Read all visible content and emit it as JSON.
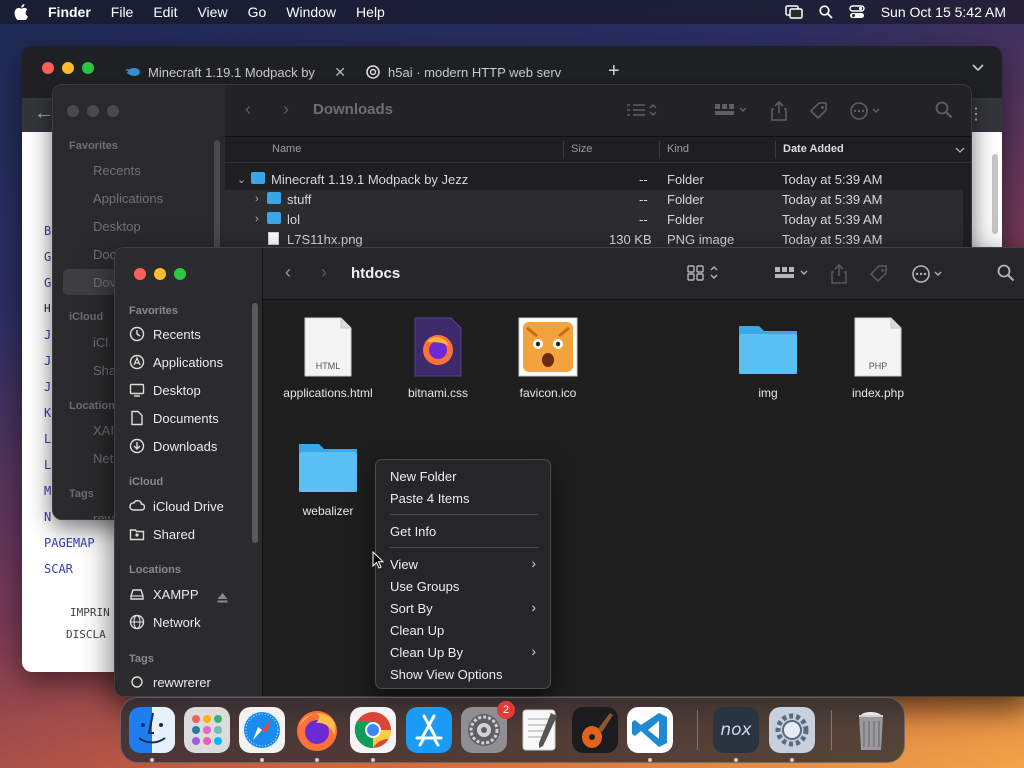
{
  "menubar": {
    "app": "Finder",
    "items": [
      "File",
      "Edit",
      "View",
      "Go",
      "Window",
      "Help"
    ],
    "datetime": "Sun Oct 15  5:42 AM"
  },
  "browser": {
    "tabs": [
      {
        "label": "Minecraft 1.19.1 Modpack by"
      },
      {
        "label": "h5ai · modern HTTP web serv"
      }
    ],
    "page_links": [
      "B",
      "G",
      "G",
      "H",
      "J",
      "J",
      "J",
      "K",
      "L",
      "L",
      "M",
      "N",
      "PAGEMAP",
      "SCAR"
    ],
    "page_text": [
      "IMPRIN",
      "DISCLA"
    ]
  },
  "finder_back": {
    "title": "Downloads",
    "sidebar": {
      "favorites_header": "Favorites",
      "favorites": [
        "Recents",
        "Applications",
        "Desktop",
        "Doc",
        "Dov"
      ],
      "icloud_header": "iCloud",
      "icloud": [
        "iCl",
        "Sha"
      ],
      "locations_header": "Location",
      "locations": [
        "XAI",
        "Net"
      ],
      "tags_header": "Tags",
      "tags": [
        "rew"
      ]
    },
    "columns": {
      "name": "Name",
      "size": "Size",
      "kind": "Kind",
      "date": "Date Added"
    },
    "rows": [
      {
        "name": "Minecraft 1.19.1 Modpack by Jezz",
        "size": "--",
        "kind": "Folder",
        "date": "Today at 5:39 AM"
      },
      {
        "name": "stuff",
        "size": "--",
        "kind": "Folder",
        "date": "Today at 5:39 AM"
      },
      {
        "name": "lol",
        "size": "--",
        "kind": "Folder",
        "date": "Today at 5:39 AM"
      },
      {
        "name": "L7S11hx.png",
        "size": "130 KB",
        "kind": "PNG image",
        "date": "Today at 5:39 AM"
      }
    ]
  },
  "finder_front": {
    "title": "htdocs",
    "sidebar": {
      "favorites_header": "Favorites",
      "favorites": [
        "Recents",
        "Applications",
        "Desktop",
        "Documents",
        "Downloads"
      ],
      "icloud_header": "iCloud",
      "icloud": [
        "iCloud Drive",
        "Shared"
      ],
      "locations_header": "Locations",
      "locations": [
        "XAMPP",
        "Network"
      ],
      "tags_header": "Tags",
      "tags": [
        "rewwrerer"
      ]
    },
    "files": [
      {
        "name": "applications.html",
        "badge": "HTML"
      },
      {
        "name": "bitnami.css",
        "badge": ""
      },
      {
        "name": "favicon.ico",
        "badge": ""
      },
      {
        "name": "img",
        "badge": ""
      },
      {
        "name": "index.php",
        "badge": "PHP"
      },
      {
        "name": "webalizer",
        "badge": ""
      }
    ]
  },
  "context_menu": {
    "items": [
      "New Folder",
      "Paste 4 Items",
      "Get Info",
      "View",
      "Use Groups",
      "Sort By",
      "Clean Up",
      "Clean Up By",
      "Show View Options"
    ]
  },
  "dock": {
    "apps": [
      "finder-icon",
      "launchpad-icon",
      "safari-icon",
      "firefox-icon",
      "chrome-icon",
      "app-store-icon",
      "system-settings-icon",
      "textedit-icon",
      "garageband-icon",
      "vscode-icon",
      "nox-icon",
      "settings-gear-icon",
      "trash-icon"
    ],
    "nox_label": "nox",
    "settings_badge": "2"
  },
  "colors": {
    "accent_blue": "#3aa6e8",
    "close": "#ff5f57",
    "minimize": "#febc2e",
    "zoom": "#28c840"
  }
}
